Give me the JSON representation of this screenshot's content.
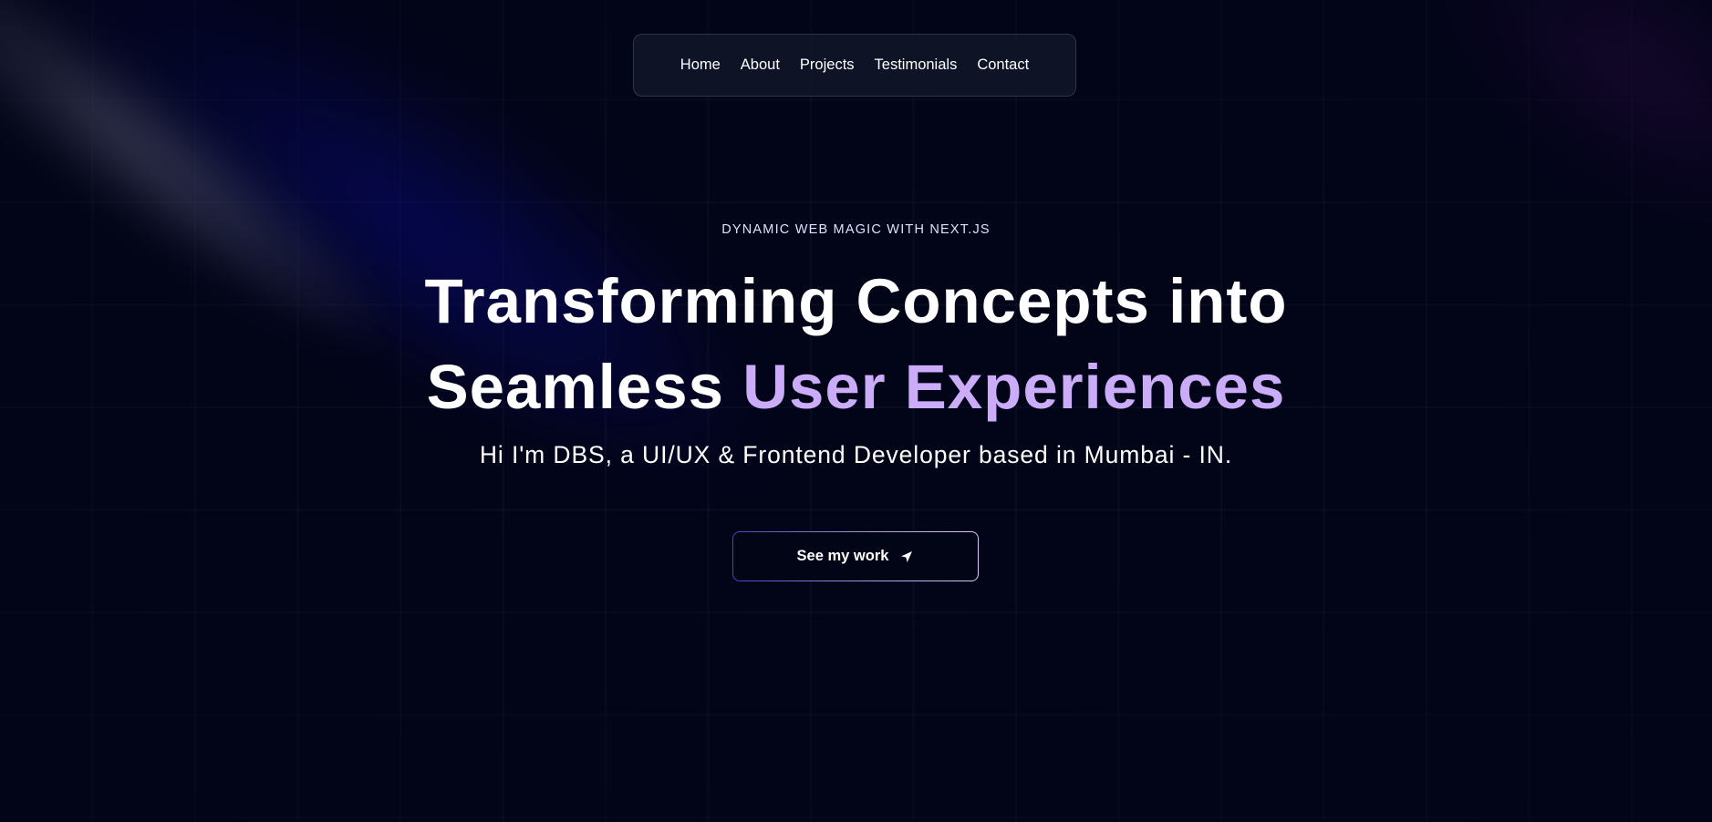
{
  "nav": {
    "links": [
      "Home",
      "About",
      "Projects",
      "Testimonials",
      "Contact"
    ]
  },
  "hero": {
    "kicker": "DYNAMIC WEB MAGIC WITH NEXT.JS",
    "headline_line1": "Transforming Concepts into",
    "headline_line2_plain": "Seamless",
    "headline_line2_accent": "User Experiences",
    "subtitle": "Hi I'm DBS, a UI/UX & Frontend Developer based in Mumbai - IN.",
    "cta_label": "See my work",
    "cta_icon": "send-arrow-icon"
  },
  "colors": {
    "background": "#020418",
    "accent_purple": "#cbacf9",
    "nav_bg": "#111928"
  }
}
